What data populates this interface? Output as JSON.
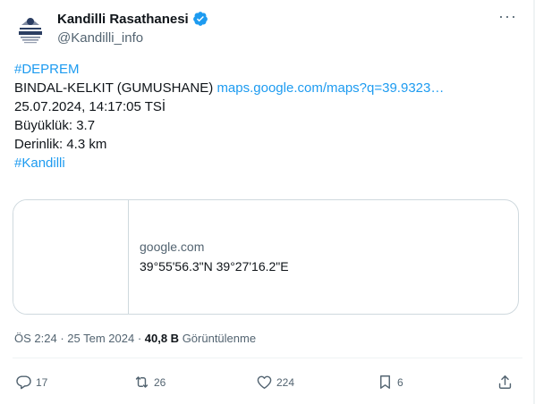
{
  "account": {
    "name": "Kandilli Rasathanesi",
    "handle": "@Kandilli_info",
    "avatar_text": "KANDİLLİ"
  },
  "more_label": "···",
  "tweet": {
    "hashtag_top": "#DEPREM",
    "location_prefix": "BINDAL-KELKIT (GUMUSHANE)",
    "map_link": "maps.google.com/maps?q=39.9323…",
    "datetime": "25.07.2024, 14:17:05 TSİ",
    "magnitude": "Büyüklük: 3.7",
    "depth": "Derinlik: 4.3 km",
    "hashtag_bottom": "#Kandilli"
  },
  "card": {
    "domain": "google.com",
    "title": "39°55'56.3\"N 39°27'16.2\"E"
  },
  "meta": {
    "time": "ÖS 2:24",
    "separator1": " · ",
    "date": "25 Tem 2024",
    "separator2": " · ",
    "views_count": "40,8 B",
    "views_label": " Görüntülenme"
  },
  "actions": {
    "reply_count": "17",
    "retweet_count": "26",
    "like_count": "224",
    "bookmark_count": "6"
  },
  "colors": {
    "link": "#1d9bf0",
    "verified": "#1d9bf0",
    "muted": "#536471"
  }
}
